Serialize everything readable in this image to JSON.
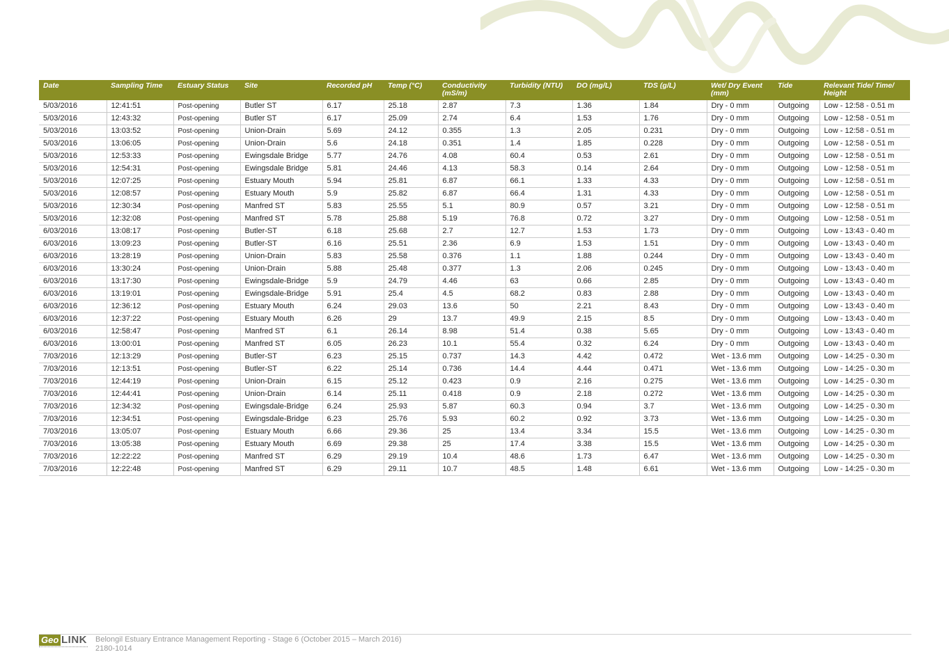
{
  "table": {
    "headers": [
      "Date",
      "Sampling Time",
      "Estuary Status",
      "Site",
      "Recorded pH",
      "Temp (°C)",
      "Conductivity (mS/m)",
      "Turbidity (NTU)",
      "DO (mg/L)",
      "TDS (g/L)",
      "Wet/ Dry Event (mm)",
      "Tide",
      "Relevant Tide/ Time/ Height"
    ],
    "rows": [
      [
        "5/03/2016",
        "12:41:51",
        "Post-opening",
        "Butler ST",
        "6.17",
        "25.18",
        "2.87",
        "7.3",
        "1.36",
        "1.84",
        "Dry - 0 mm",
        "Outgoing",
        "Low - 12:58 - 0.51 m"
      ],
      [
        "5/03/2016",
        "12:43:32",
        "Post-opening",
        "Butler ST",
        "6.17",
        "25.09",
        "2.74",
        "6.4",
        "1.53",
        "1.76",
        "Dry - 0 mm",
        "Outgoing",
        "Low - 12:58 - 0.51 m"
      ],
      [
        "5/03/2016",
        "13:03:52",
        "Post-opening",
        "Union-Drain",
        "5.69",
        "24.12",
        "0.355",
        "1.3",
        "2.05",
        "0.231",
        "Dry - 0 mm",
        "Outgoing",
        "Low - 12:58 - 0.51 m"
      ],
      [
        "5/03/2016",
        "13:06:05",
        "Post-opening",
        "Union-Drain",
        "5.6",
        "24.18",
        "0.351",
        "1.4",
        "1.85",
        "0.228",
        "Dry - 0 mm",
        "Outgoing",
        "Low - 12:58 - 0.51 m"
      ],
      [
        "5/03/2016",
        "12:53:33",
        "Post-opening",
        "Ewingsdale Bridge",
        "5.77",
        "24.76",
        "4.08",
        "60.4",
        "0.53",
        "2.61",
        "Dry - 0 mm",
        "Outgoing",
        "Low - 12:58 - 0.51 m"
      ],
      [
        "5/03/2016",
        "12:54:31",
        "Post-opening",
        "Ewingsdale Bridge",
        "5.81",
        "24.46",
        "4.13",
        "58.3",
        "0.14",
        "2.64",
        "Dry - 0 mm",
        "Outgoing",
        "Low - 12:58 - 0.51 m"
      ],
      [
        "5/03/2016",
        "12:07:25",
        "Post-opening",
        "Estuary Mouth",
        "5.94",
        "25.81",
        "6.87",
        "66.1",
        "1.33",
        "4.33",
        "Dry - 0 mm",
        "Outgoing",
        "Low - 12:58 - 0.51 m"
      ],
      [
        "5/03/2016",
        "12:08:57",
        "Post-opening",
        "Estuary Mouth",
        "5.9",
        "25.82",
        "6.87",
        "66.4",
        "1.31",
        "4.33",
        "Dry - 0 mm",
        "Outgoing",
        "Low - 12:58 - 0.51 m"
      ],
      [
        "5/03/2016",
        "12:30:34",
        "Post-opening",
        "Manfred ST",
        "5.83",
        "25.55",
        "5.1",
        "80.9",
        "0.57",
        "3.21",
        "Dry - 0 mm",
        "Outgoing",
        "Low - 12:58 - 0.51 m"
      ],
      [
        "5/03/2016",
        "12:32:08",
        "Post-opening",
        "Manfred ST",
        "5.78",
        "25.88",
        "5.19",
        "76.8",
        "0.72",
        "3.27",
        "Dry - 0 mm",
        "Outgoing",
        "Low - 12:58 - 0.51 m"
      ],
      [
        "6/03/2016",
        "13:08:17",
        "Post-opening",
        "Butler-ST",
        "6.18",
        "25.68",
        "2.7",
        "12.7",
        "1.53",
        "1.73",
        "Dry - 0 mm",
        "Outgoing",
        "Low - 13:43 - 0.40 m"
      ],
      [
        "6/03/2016",
        "13:09:23",
        "Post-opening",
        "Butler-ST",
        "6.16",
        "25.51",
        "2.36",
        "6.9",
        "1.53",
        "1.51",
        "Dry - 0 mm",
        "Outgoing",
        "Low - 13:43 - 0.40 m"
      ],
      [
        "6/03/2016",
        "13:28:19",
        "Post-opening",
        "Union-Drain",
        "5.83",
        "25.58",
        "0.376",
        "1.1",
        "1.88",
        "0.244",
        "Dry - 0 mm",
        "Outgoing",
        "Low - 13:43 - 0.40 m"
      ],
      [
        "6/03/2016",
        "13:30:24",
        "Post-opening",
        "Union-Drain",
        "5.88",
        "25.48",
        "0.377",
        "1.3",
        "2.06",
        "0.245",
        "Dry - 0 mm",
        "Outgoing",
        "Low - 13:43 - 0.40 m"
      ],
      [
        "6/03/2016",
        "13:17:30",
        "Post-opening",
        "Ewingsdale-Bridge",
        "5.9",
        "24.79",
        "4.46",
        "63",
        "0.66",
        "2.85",
        "Dry - 0 mm",
        "Outgoing",
        "Low - 13:43 - 0.40 m"
      ],
      [
        "6/03/2016",
        "13:19:01",
        "Post-opening",
        "Ewingsdale-Bridge",
        "5.91",
        "25.4",
        "4.5",
        "68.2",
        "0.83",
        "2.88",
        "Dry - 0 mm",
        "Outgoing",
        "Low - 13:43 - 0.40 m"
      ],
      [
        "6/03/2016",
        "12:36:12",
        "Post-opening",
        "Estuary Mouth",
        "6.24",
        "29.03",
        "13.6",
        "50",
        "2.21",
        "8.43",
        "Dry - 0 mm",
        "Outgoing",
        "Low - 13:43 - 0.40 m"
      ],
      [
        "6/03/2016",
        "12:37:22",
        "Post-opening",
        "Estuary Mouth",
        "6.26",
        "29",
        "13.7",
        "49.9",
        "2.15",
        "8.5",
        "Dry - 0 mm",
        "Outgoing",
        "Low - 13:43 - 0.40 m"
      ],
      [
        "6/03/2016",
        "12:58:47",
        "Post-opening",
        "Manfred ST",
        "6.1",
        "26.14",
        "8.98",
        "51.4",
        "0.38",
        "5.65",
        "Dry - 0 mm",
        "Outgoing",
        "Low - 13:43 - 0.40 m"
      ],
      [
        "6/03/2016",
        "13:00:01",
        "Post-opening",
        "Manfred ST",
        "6.05",
        "26.23",
        "10.1",
        "55.4",
        "0.32",
        "6.24",
        "Dry - 0 mm",
        "Outgoing",
        "Low - 13:43 - 0.40 m"
      ],
      [
        "7/03/2016",
        "12:13:29",
        "Post-opening",
        "Butler-ST",
        "6.23",
        "25.15",
        "0.737",
        "14.3",
        "4.42",
        "0.472",
        "Wet - 13.6 mm",
        "Outgoing",
        "Low - 14:25 - 0.30 m"
      ],
      [
        "7/03/2016",
        "12:13:51",
        "Post-opening",
        "Butler-ST",
        "6.22",
        "25.14",
        "0.736",
        "14.4",
        "4.44",
        "0.471",
        "Wet - 13.6 mm",
        "Outgoing",
        "Low - 14:25 - 0.30 m"
      ],
      [
        "7/03/2016",
        "12:44:19",
        "Post-opening",
        "Union-Drain",
        "6.15",
        "25.12",
        "0.423",
        "0.9",
        "2.16",
        "0.275",
        "Wet - 13.6 mm",
        "Outgoing",
        "Low - 14:25 - 0.30 m"
      ],
      [
        "7/03/2016",
        "12:44:41",
        "Post-opening",
        "Union-Drain",
        "6.14",
        "25.11",
        "0.418",
        "0.9",
        "2.18",
        "0.272",
        "Wet - 13.6 mm",
        "Outgoing",
        "Low - 14:25 - 0.30 m"
      ],
      [
        "7/03/2016",
        "12:34:32",
        "Post-opening",
        "Ewingsdale-Bridge",
        "6.24",
        "25.93",
        "5.87",
        "60.3",
        "0.94",
        "3.7",
        "Wet - 13.6 mm",
        "Outgoing",
        "Low - 14:25 - 0.30 m"
      ],
      [
        "7/03/2016",
        "12:34:51",
        "Post-opening",
        "Ewingsdale-Bridge",
        "6.23",
        "25.76",
        "5.93",
        "60.2",
        "0.92",
        "3.73",
        "Wet - 13.6 mm",
        "Outgoing",
        "Low - 14:25 - 0.30 m"
      ],
      [
        "7/03/2016",
        "13:05:07",
        "Post-opening",
        "Estuary Mouth",
        "6.66",
        "29.36",
        "25",
        "13.4",
        "3.34",
        "15.5",
        "Wet - 13.6 mm",
        "Outgoing",
        "Low - 14:25 - 0.30 m"
      ],
      [
        "7/03/2016",
        "13:05:38",
        "Post-opening",
        "Estuary Mouth",
        "6.69",
        "29.38",
        "25",
        "17.4",
        "3.38",
        "15.5",
        "Wet - 13.6 mm",
        "Outgoing",
        "Low - 14:25 - 0.30 m"
      ],
      [
        "7/03/2016",
        "12:22:22",
        "Post-opening",
        "Manfred ST",
        "6.29",
        "29.19",
        "10.4",
        "48.6",
        "1.73",
        "6.47",
        "Wet - 13.6 mm",
        "Outgoing",
        "Low - 14:25 - 0.30 m"
      ],
      [
        "7/03/2016",
        "12:22:48",
        "Post-opening",
        "Manfred ST",
        "6.29",
        "29.11",
        "10.7",
        "48.5",
        "1.48",
        "6.61",
        "Wet - 13.6 mm",
        "Outgoing",
        "Low - 14:25 - 0.30 m"
      ]
    ]
  },
  "footer": {
    "logo_geo": "Geo",
    "logo_link": "LINK",
    "title": "Belongil Estuary Entrance Management Reporting - Stage 6 (October 2015 – March 2016)",
    "doc_number": "2180-1014"
  },
  "colors": {
    "header_bg": "#8a8f25",
    "decor": "#e6e8cf"
  }
}
